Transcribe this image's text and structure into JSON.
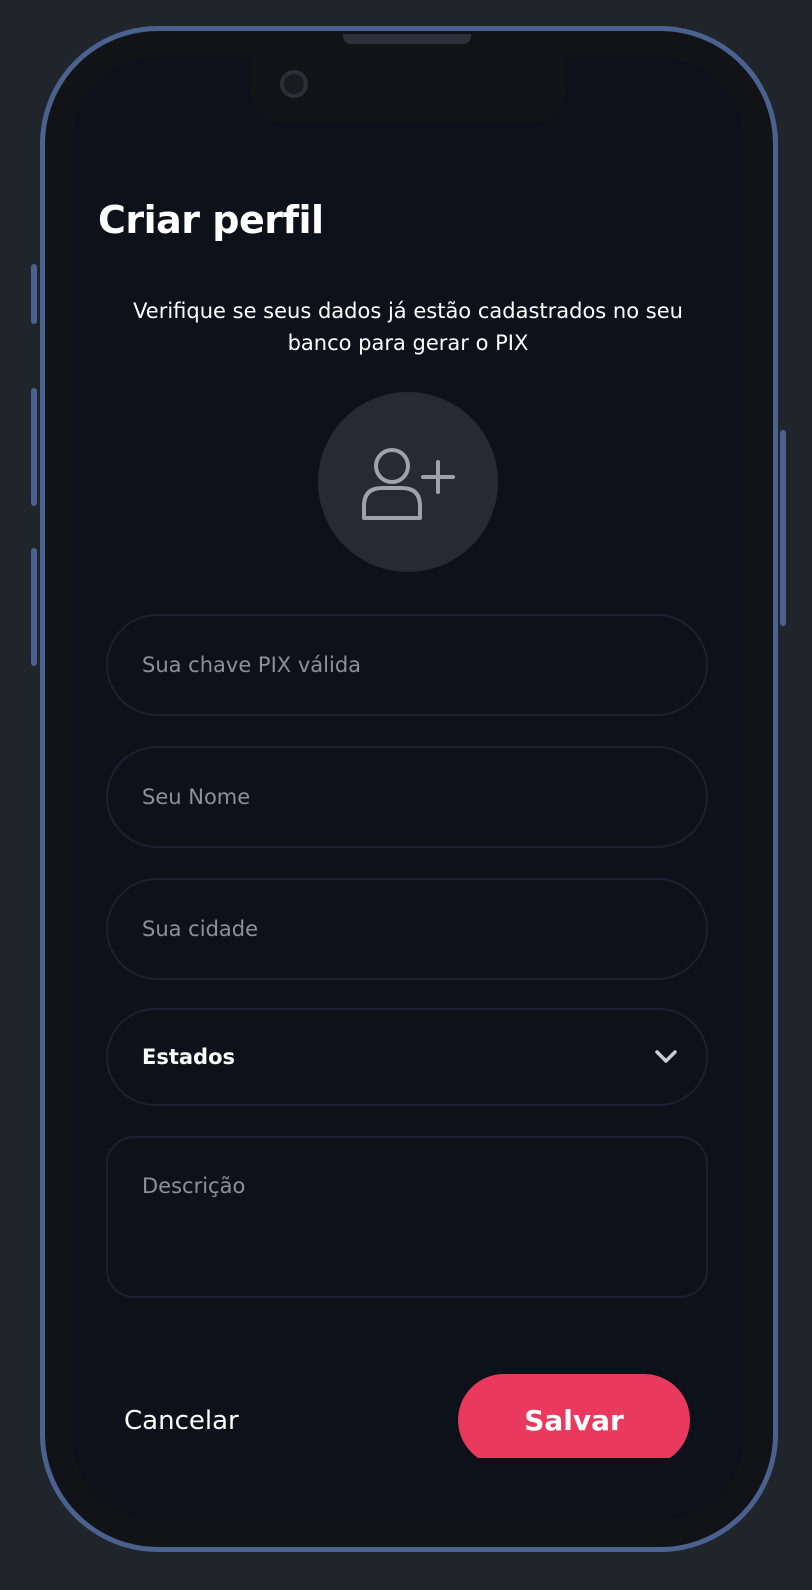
{
  "header": {
    "title": "Criar perfil",
    "subtitle": "Verifique se seus dados já estão cadastrados no seu banco para gerar o PIX"
  },
  "avatar": {
    "icon": "user-plus-icon"
  },
  "form": {
    "pix_placeholder": "Sua chave PIX  válida",
    "name_placeholder": "Seu Nome",
    "city_placeholder": "Sua cidade",
    "state_selected": "Estados",
    "description_placeholder": "Descrição"
  },
  "actions": {
    "cancel_label": "Cancelar",
    "save_label": "Salvar"
  },
  "colors": {
    "accent": "#e93a5d",
    "background": "#0d111a",
    "avatar_bg": "#252b33",
    "frame": "#4b6290"
  }
}
